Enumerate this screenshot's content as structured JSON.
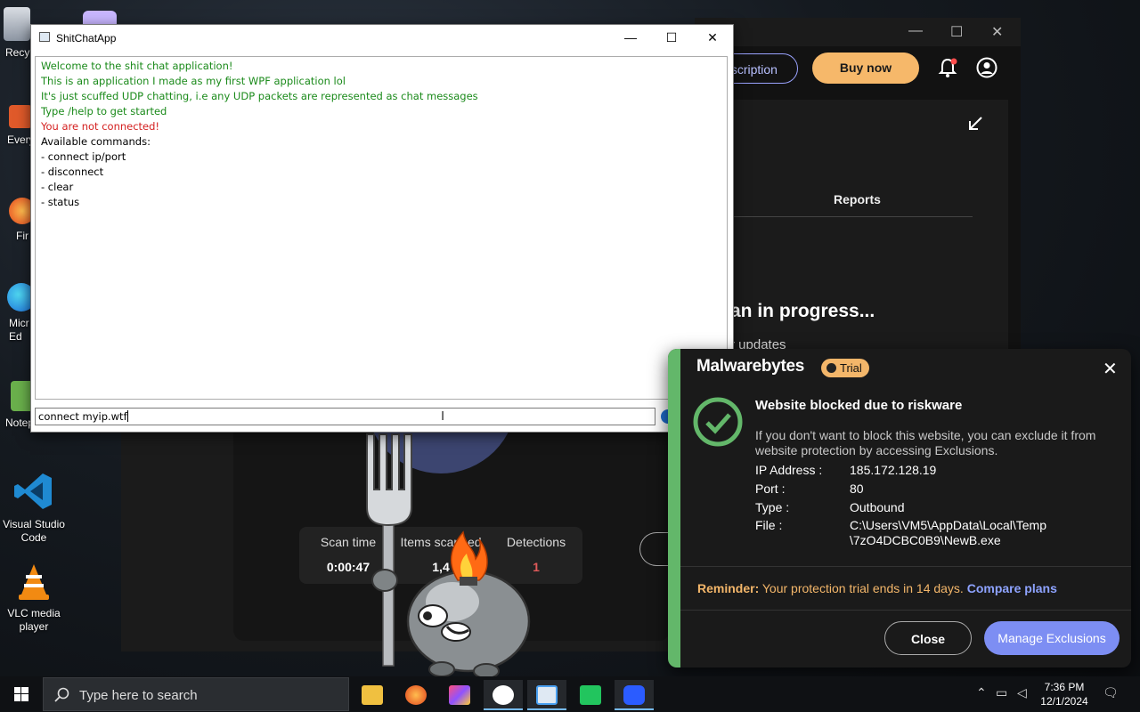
{
  "desktop": {
    "icons": [
      {
        "label": "Recy"
      },
      {
        "label": "Every"
      },
      {
        "label": "Fir"
      },
      {
        "label": "Micr\nEd"
      },
      {
        "label": "Notep"
      },
      {
        "label": "Visual Studio Code"
      },
      {
        "label": "VLC media player"
      }
    ]
  },
  "malwarebytes_bg": {
    "subscription_label": "bscription",
    "buy_label": "Buy now",
    "reports_label": "Reports",
    "scan_title": "an in progress...",
    "updates_label": "r updates",
    "stats": [
      {
        "label": "Scan time",
        "value": "0:00:47"
      },
      {
        "label": "Items scanned",
        "value": "1,4"
      },
      {
        "label": "Detections",
        "value": "1"
      }
    ],
    "colors": {
      "accent": "#f6b86a",
      "detections": "#e05a5a"
    }
  },
  "chat": {
    "title": "ShitChatApp",
    "window_buttons": {
      "minimize": "—",
      "maximize": "☐",
      "close": "✕"
    },
    "lines": [
      {
        "text": "Welcome to the shit chat application!",
        "color": "#1a8a1a"
      },
      {
        "text": "This is an application I made as my first WPF application lol",
        "color": "#1a8a1a"
      },
      {
        "text": "It's just scuffed UDP chatting, i.e any UDP packets are represented as chat messages",
        "color": "#1a8a1a"
      },
      {
        "text": "Type /help to get started",
        "color": "#1a8a1a"
      },
      {
        "text": "You are not connected!",
        "color": "#d42020"
      },
      {
        "text": "Available commands:",
        "color": "#000000"
      },
      {
        "text": "- connect ip/port",
        "color": "#000000"
      },
      {
        "text": "- disconnect",
        "color": "#000000"
      },
      {
        "text": "- clear",
        "color": "#000000"
      },
      {
        "text": "- status",
        "color": "#000000"
      }
    ],
    "input_value": "connect myip.wtf"
  },
  "notification": {
    "brand": "Malwarebytes",
    "trial_label": "Trial",
    "close_icon": "✕",
    "heading": "Website blocked due to riskware",
    "description": "If you don't want to block this website, you can exclude it from website protection by accessing Exclusions.",
    "details": [
      {
        "key": "IP Address :",
        "value": "185.172.128.19"
      },
      {
        "key": "Port :",
        "value": "80"
      },
      {
        "key": "Type :",
        "value": "Outbound"
      },
      {
        "key": "File :",
        "value": "C:\\Users\\VM5\\AppData\\Local\\Temp\n\\7zO4DCBC0B9\\NewB.exe"
      }
    ],
    "reminder_bold": "Reminder:",
    "reminder_text": " Your protection trial ends in 14 days. ",
    "reminder_link": "Compare plans",
    "close_button": "Close",
    "manage_button": "Manage Exclusions",
    "colors": {
      "success": "#63b76a",
      "trial": "#f3b66a",
      "primary": "#7d8ef3"
    }
  },
  "taskbar": {
    "search_placeholder": "Type here to search",
    "time": "7:36 PM",
    "date": "12/1/2024",
    "apps": [
      {
        "icon": "file-explorer-icon",
        "color": "#f0c040"
      },
      {
        "icon": "firefox-icon",
        "color": "#ff7a20"
      },
      {
        "icon": "xmind-icon",
        "color": "#d04fd8"
      },
      {
        "icon": "teamviewer-icon",
        "color": "#ffffff"
      },
      {
        "icon": "wpf-app-icon",
        "color": "#4aa0f0"
      },
      {
        "icon": "t-app-icon",
        "color": "#22c55e"
      },
      {
        "icon": "malwarebytes-icon",
        "color": "#2b5cff"
      }
    ]
  }
}
